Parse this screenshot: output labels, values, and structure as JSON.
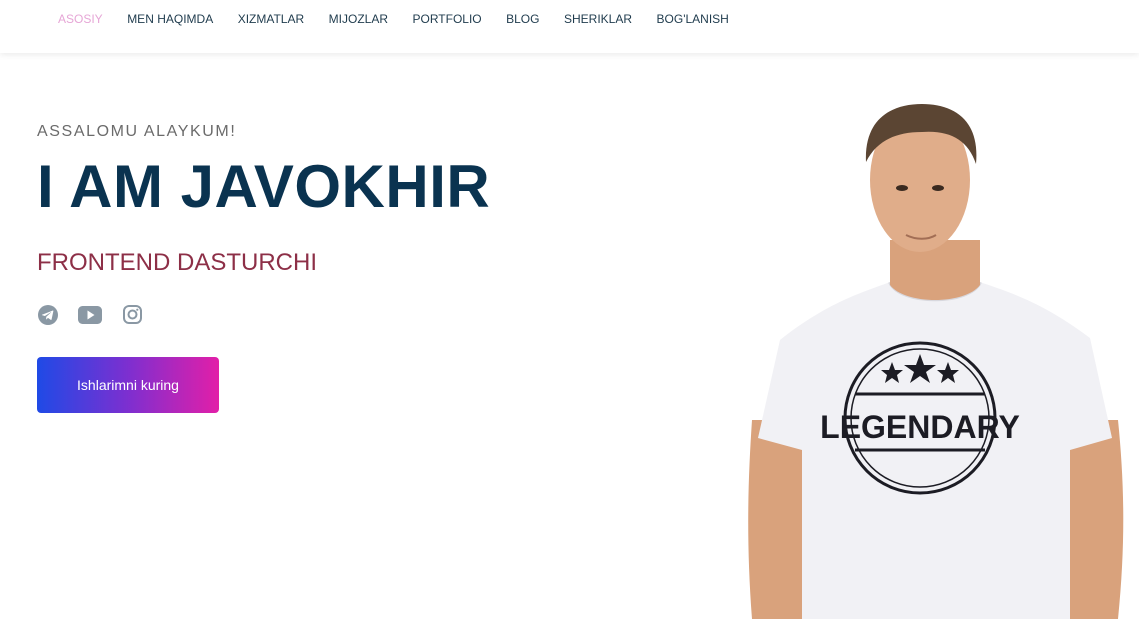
{
  "nav": {
    "items": [
      {
        "label": "ASOSIY",
        "active": true
      },
      {
        "label": "MEN HAQIMDA"
      },
      {
        "label": "XIZMATLAR"
      },
      {
        "label": "MIJOZLAR"
      },
      {
        "label": "PORTFOLIO"
      },
      {
        "label": "BLOG"
      },
      {
        "label": "SHERIKLAR"
      },
      {
        "label": "BOG'LANISH"
      }
    ]
  },
  "hero": {
    "greeting": "ASSALOMU ALAYKUM!",
    "headline": "I AM JAVOKHIR",
    "role": "FRONTEND DASTURCHI",
    "cta_label": "Ishlarimni kuring",
    "shirt_text": "LEGENDARY",
    "socials": [
      "telegram-icon",
      "youtube-icon",
      "instagram-icon"
    ]
  },
  "colors": {
    "nav_active": "#e6a6d6",
    "nav_text": "#1f3b4d",
    "headline": "#0a3350",
    "role": "#8d2f47",
    "icon_gray": "#8a98a4",
    "cta_gradient_start": "#1f4ae6",
    "cta_gradient_end": "#e21fa8"
  }
}
